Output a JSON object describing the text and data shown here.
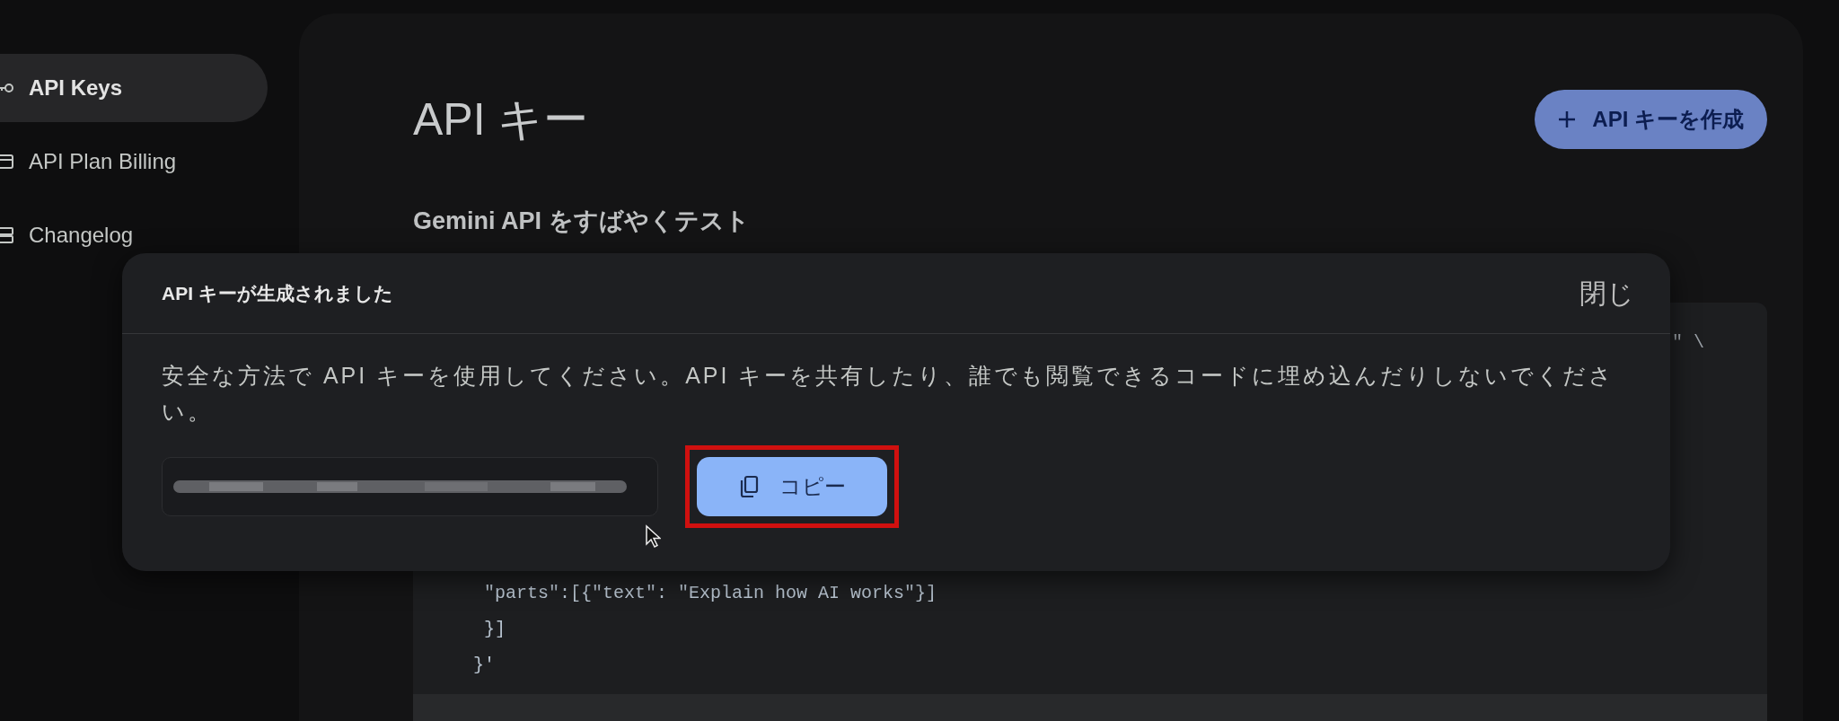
{
  "sidebar": {
    "items": [
      {
        "label": "API Keys",
        "selected": true,
        "kind": "key"
      },
      {
        "label": "API Plan Billing",
        "selected": false,
        "kind": "billing"
      },
      {
        "label": "Changelog",
        "selected": false,
        "kind": "changelog"
      }
    ]
  },
  "page": {
    "title": "API キー",
    "create_button": "API キーを作成",
    "section_title": "Gemini API をすばやくテスト",
    "code": {
      "fragment": "\" \\",
      "lines": [
        "  \"parts\":[{\"text\": \"Explain how AI works\"}]",
        "  }]",
        " }'"
      ]
    }
  },
  "dialog": {
    "title": "API キーが生成されました",
    "close": "閉じ",
    "message": "安全な方法で API キーを使用してください。API キーを共有したり、誰でも閲覧できるコードに埋め込んだりしないでください。",
    "copy_button": "コピー"
  }
}
